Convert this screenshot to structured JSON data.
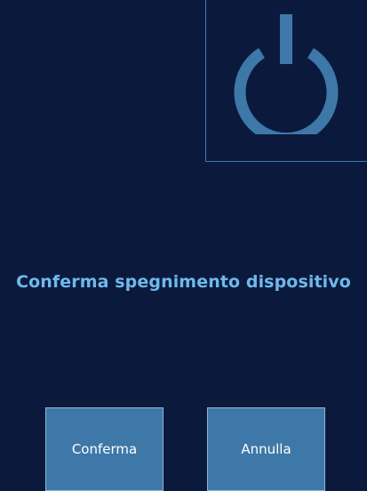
{
  "dialog": {
    "message": "Conferma spegnimento dispositivo"
  },
  "power_icon": {
    "name": "power-icon",
    "color": "#3e78a8"
  },
  "buttons": {
    "confirm_label": "Conferma",
    "cancel_label": "Annulla"
  },
  "colors": {
    "background": "#0b1a3c",
    "accent": "#3e78a8",
    "message_text": "#6fb8ec",
    "button_text": "#ffffff"
  }
}
